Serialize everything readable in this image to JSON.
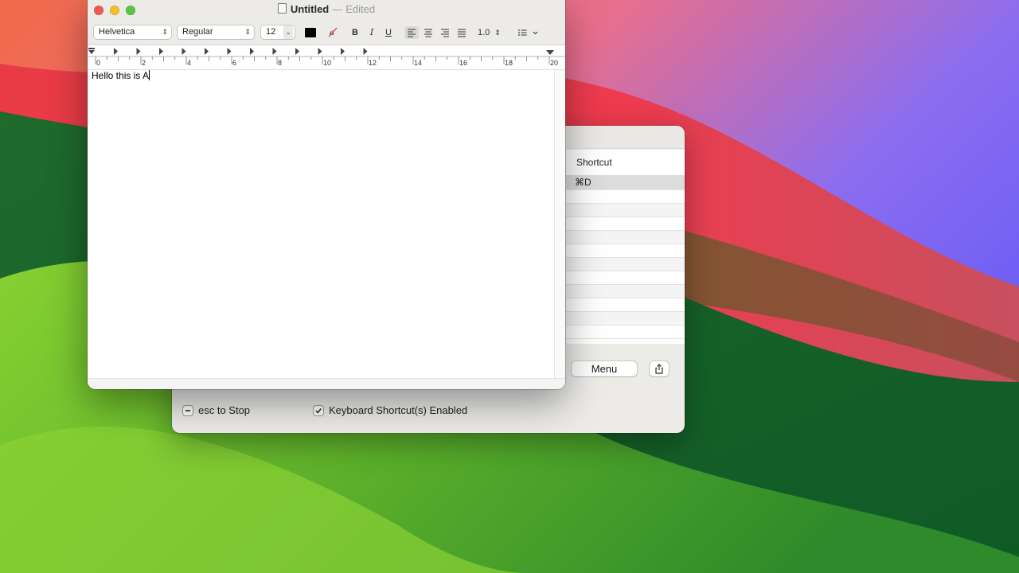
{
  "textedit": {
    "title": "Untitled",
    "title_separator": "—",
    "status": "Edited",
    "toolbar": {
      "font_family": "Helvetica",
      "font_style": "Regular",
      "font_size": "12",
      "text_color": "#000000",
      "bold": "B",
      "italic": "I",
      "underline": "U",
      "line_spacing": "1.0",
      "active_alignment": "left"
    },
    "ruler_labels": [
      "0",
      "2",
      "4",
      "6",
      "8",
      "10",
      "12",
      "14",
      "16",
      "18",
      "20"
    ],
    "document_text": "Hello this is A"
  },
  "helper_window": {
    "table_header": "Shortcut",
    "selected_shortcut": "⌘D",
    "menu_button": "Menu",
    "esc_checkbox_label": "esc to Stop",
    "esc_checkbox_state": "mixed",
    "shortcut_checkbox_label": "Keyboard Shortcut(s) Enabled",
    "shortcut_checkbox_state": "checked"
  },
  "colors": {
    "close": "#ee5a52",
    "minimize": "#f5bd2e",
    "zoom": "#5ac43e"
  }
}
